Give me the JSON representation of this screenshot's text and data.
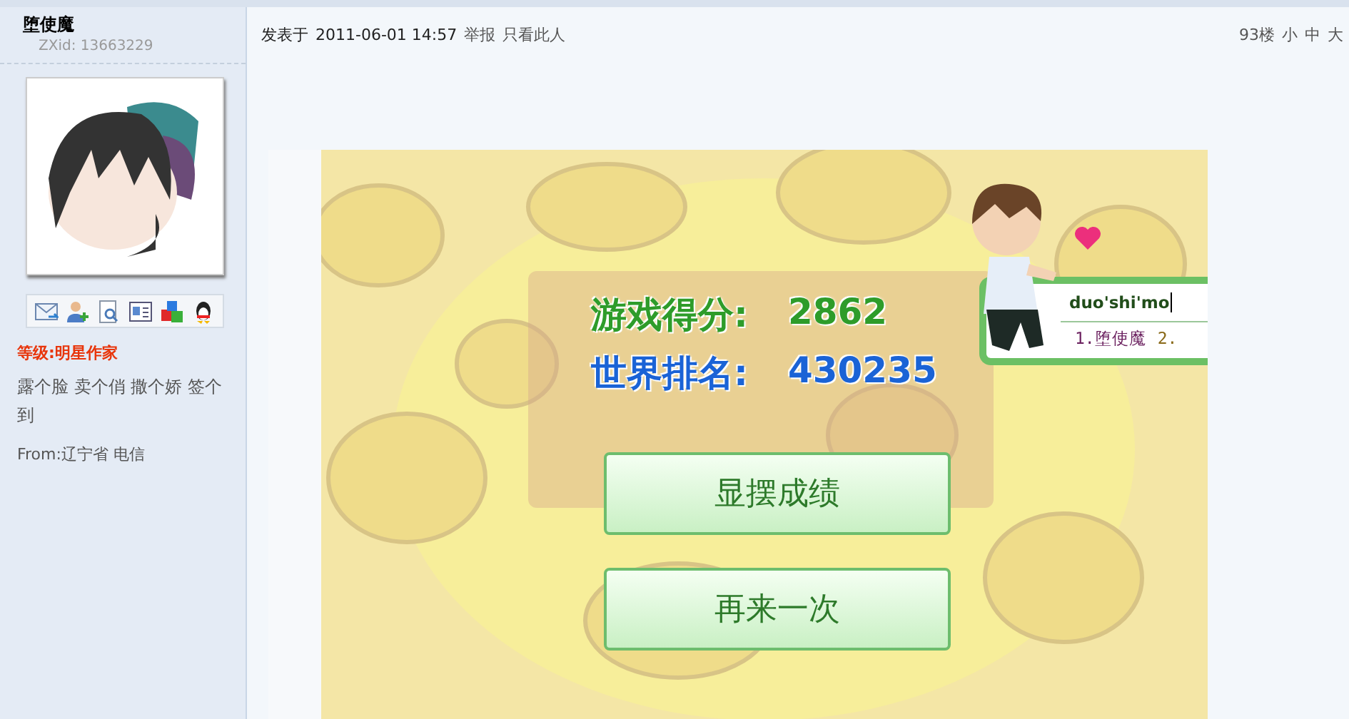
{
  "user": {
    "name": "堕使魔",
    "zxid": "ZXid: 13663229",
    "level": "等级:明星作家",
    "actions": "露个脸 卖个俏 撒个娇 签个到",
    "from": "From:辽宁省 电信"
  },
  "post_header": {
    "posted": "发表于",
    "datetime": "2011-06-01 14:57",
    "links": [
      "举报",
      "只看此人"
    ],
    "floor": "93楼",
    "sizes": [
      "小",
      "中",
      "大"
    ]
  },
  "game": {
    "score_label": "游戏得分:",
    "score": "2862",
    "rank_label": "世界排名:",
    "rank": "430235",
    "buttons": [
      "显摆成绩",
      "再来一次"
    ]
  },
  "ime": {
    "input": "duo'shi'mo",
    "candidates": [
      "1.堕使魔",
      "2."
    ]
  }
}
